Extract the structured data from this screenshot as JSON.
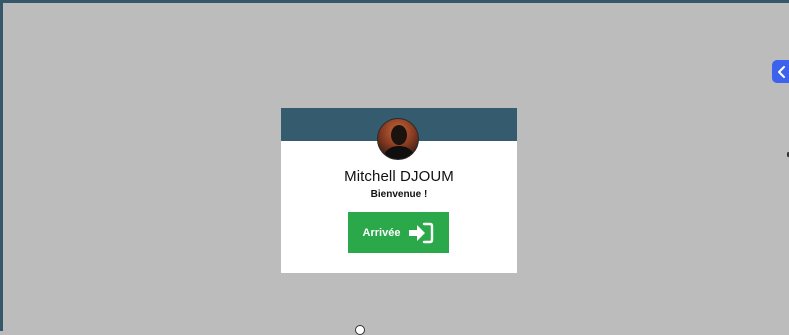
{
  "user": {
    "name": "Mitchell DJOUM",
    "greeting": "Bienvenue !"
  },
  "actions": {
    "arrival_label": "Arrivée"
  },
  "icons": {
    "side_toggle": "chevron-left-icon",
    "arrival": "sign-in-icon"
  },
  "colors": {
    "backdrop": "#bcbcbc",
    "card_header": "#355c6e",
    "arrival_button": "#2aa84a",
    "side_toggle": "#3c62ee"
  }
}
